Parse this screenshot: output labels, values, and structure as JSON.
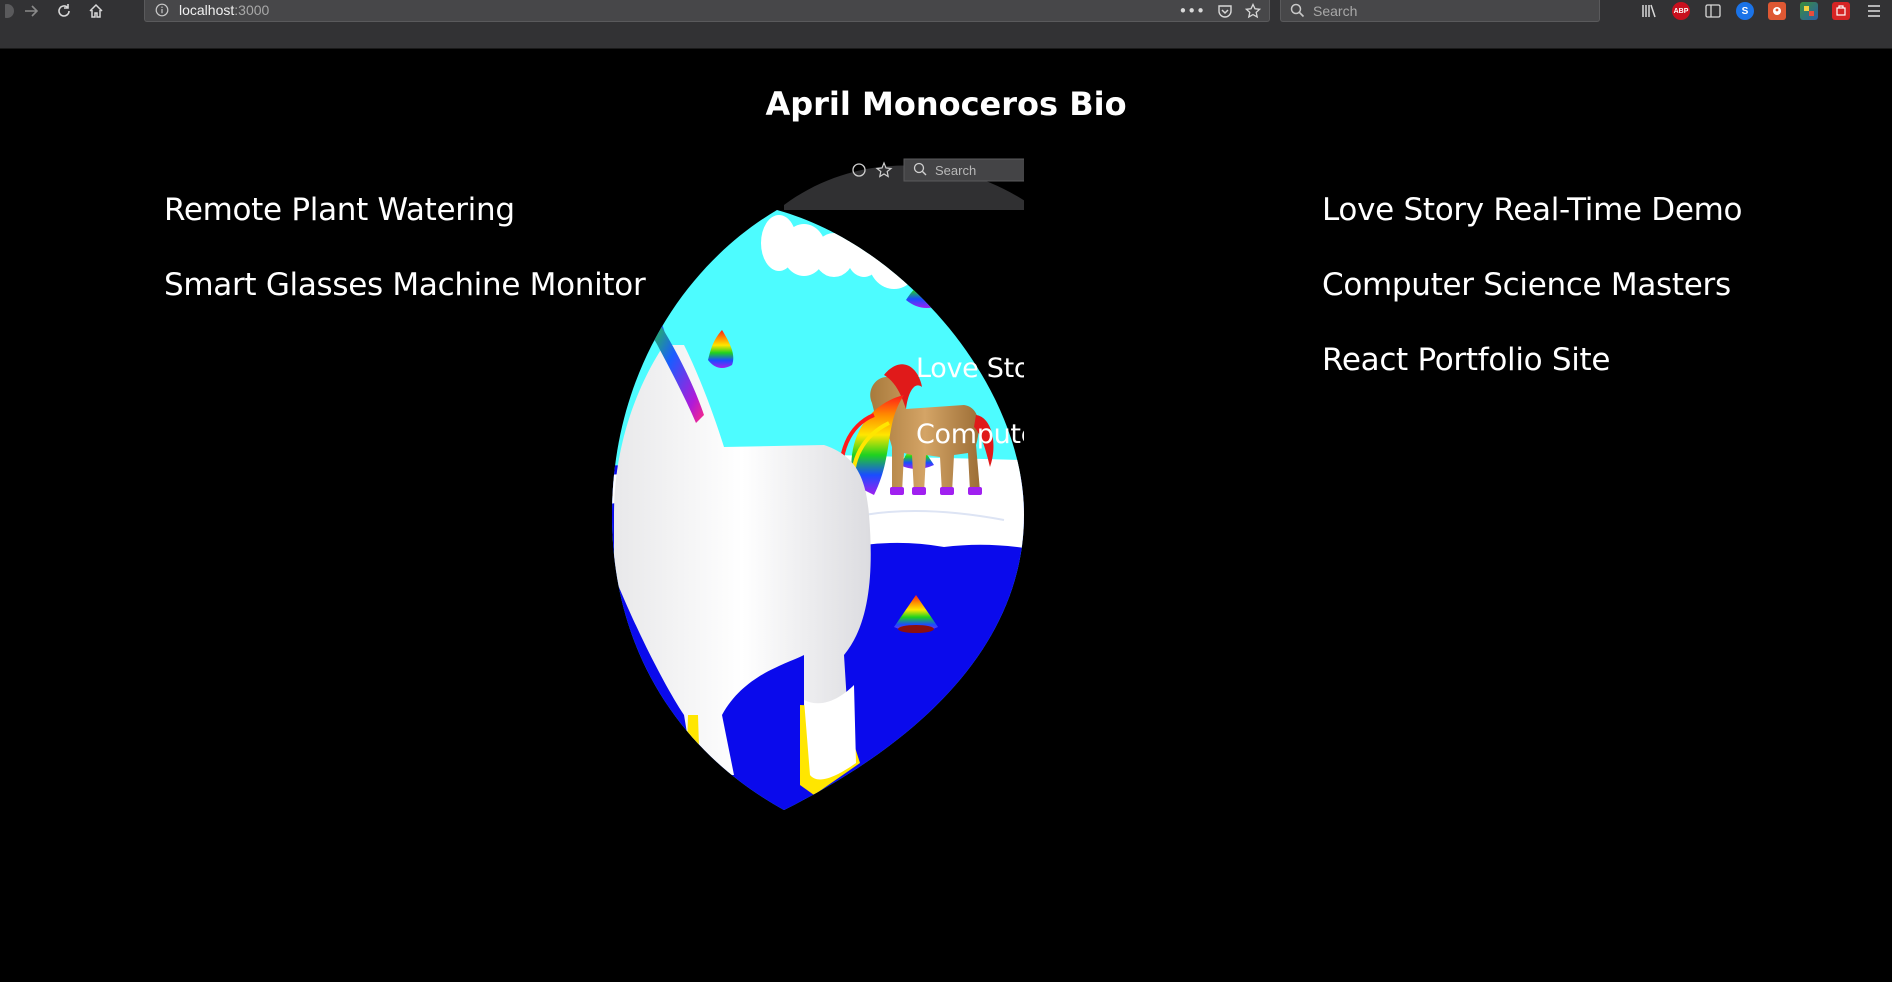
{
  "browser": {
    "url_host": "localhost",
    "url_port": ":3000",
    "search_placeholder": "Search",
    "toolbar_icons": [
      "library-icon",
      "adblock-icon",
      "reader-view-icon",
      "s-extension-icon",
      "duckduckgo-icon",
      "color-picker-icon",
      "screenshot-icon"
    ],
    "adblock_label": "ABP"
  },
  "page": {
    "title": "April Monoceros Bio",
    "left_links": [
      "Remote Plant Watering",
      "Smart Glasses Machine Monitor"
    ],
    "right_links": [
      "Love Story Real-Time Demo",
      "Computer Science Masters",
      "React Portfolio Site"
    ]
  },
  "lens": {
    "search_placeholder": "Search",
    "visible_texts": [
      "Love Story demo",
      "Computer Science M"
    ]
  },
  "colors": {
    "sky": "#4dfcff",
    "water": "#0a0aec",
    "snow": "#ffffff",
    "chrome": "#323234"
  }
}
